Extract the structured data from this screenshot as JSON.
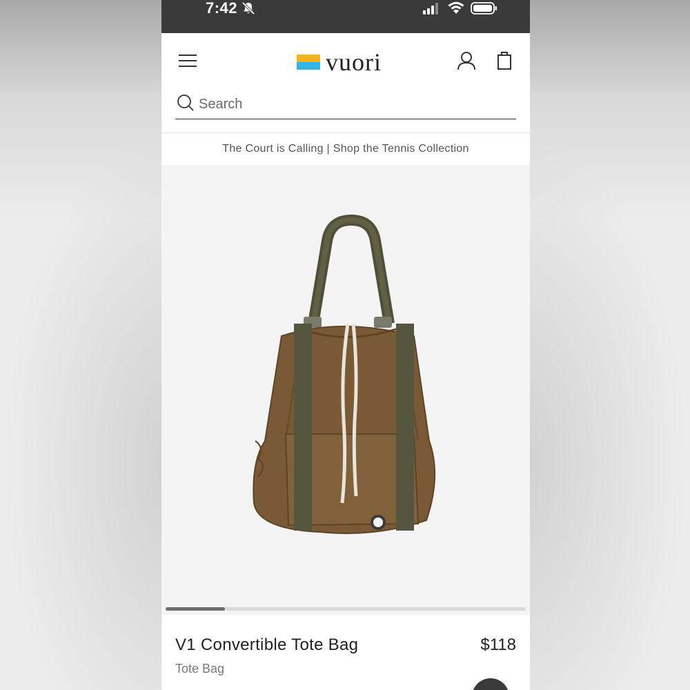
{
  "status_bar": {
    "time": "7:42",
    "icons": [
      "mute-bell-icon",
      "signal-icon",
      "wifi-icon",
      "battery-icon"
    ]
  },
  "header": {
    "brand": "vuori",
    "icons": [
      "menu-icon",
      "account-icon",
      "cart-icon"
    ],
    "brand_colors": [
      "#f3b31e",
      "#2fb5e8"
    ]
  },
  "search": {
    "placeholder": "Search",
    "value": ""
  },
  "promo": {
    "text": "The Court is Calling | Shop the Tennis Collection"
  },
  "gallery": {
    "progress_fraction": 0.165
  },
  "product": {
    "name": "V1 Convertible Tote Bag",
    "price": "$118",
    "category": "Tote Bag",
    "color": "#7a5a36"
  }
}
